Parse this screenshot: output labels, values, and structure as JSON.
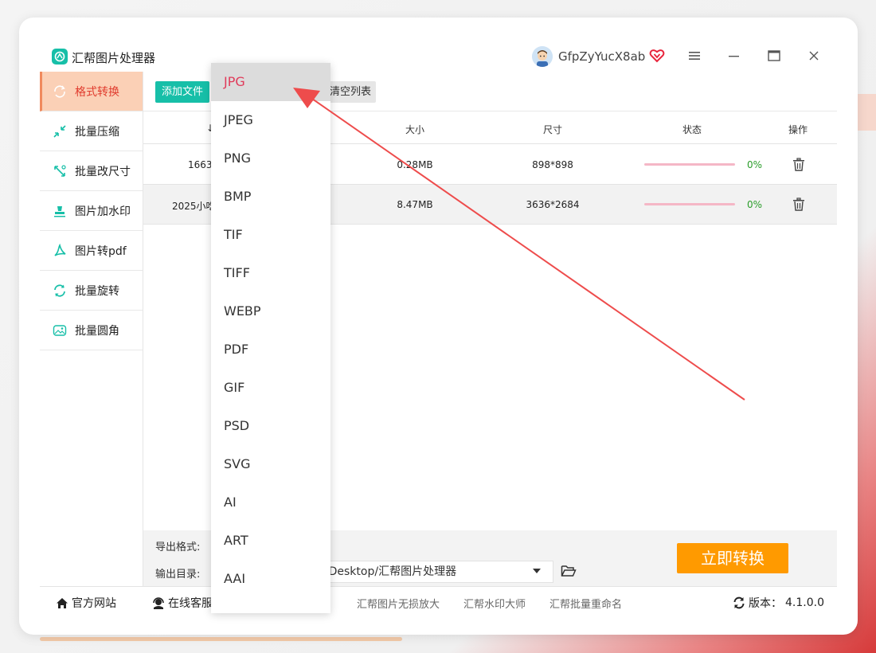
{
  "window": {
    "app_title": "汇帮图片处理器",
    "username": "GfpZyYucX8ab"
  },
  "sidebar": {
    "items": [
      {
        "label": "格式转换",
        "icon": "format-convert-icon",
        "active": true
      },
      {
        "label": "批量压缩",
        "icon": "compress-icon"
      },
      {
        "label": "批量改尺寸",
        "icon": "resize-icon"
      },
      {
        "label": "图片加水印",
        "icon": "watermark-icon"
      },
      {
        "label": "图片转pdf",
        "icon": "pdf-icon"
      },
      {
        "label": "批量旋转",
        "icon": "rotate-icon"
      },
      {
        "label": "批量圆角",
        "icon": "round-corner-icon"
      }
    ]
  },
  "toolbar": {
    "add_files": "添加文件",
    "clear_list": "清空列表"
  },
  "table": {
    "headers": [
      "大小",
      "尺寸",
      "状态",
      "操作"
    ],
    "name_header_fragment": "↓",
    "rows": [
      {
        "name": "1663(",
        "size": "0.28MB",
        "dimensions": "898*898",
        "progress_pct": "0%",
        "progress": 0
      },
      {
        "name": "2025小吃",
        "size": "8.47MB",
        "dimensions": "3636*2684",
        "progress_pct": "0%",
        "progress": 0
      }
    ]
  },
  "bottom": {
    "export_format_label": "导出格式:",
    "output_dir_label": "输出目录:",
    "output_dir_value": "3/Desktop/汇帮图片处理器",
    "convert_button": "立即转换"
  },
  "footer": {
    "official_site": "官方网站",
    "online_support": "在线客服",
    "links": [
      "汇帮图片无损放大",
      "汇帮水印大师",
      "汇帮批量重命名"
    ],
    "version_label": "版本：",
    "version_value": "4.1.0.0"
  },
  "format_dropdown": {
    "selected": "JPG",
    "options": [
      "JPG",
      "JPEG",
      "PNG",
      "BMP",
      "TIF",
      "TIFF",
      "WEBP",
      "PDF",
      "GIF",
      "PSD",
      "SVG",
      "AI",
      "ART",
      "AAI"
    ]
  },
  "colors": {
    "accent_teal": "#17bfa8",
    "active_bg": "#fbd0b6",
    "active_text": "#e03b2d",
    "convert_orange": "#ff9a00",
    "annotation_arrow": "#ee4c4c",
    "progress_pink": "#f5b7c6",
    "pct_green": "#2a9d2a"
  }
}
